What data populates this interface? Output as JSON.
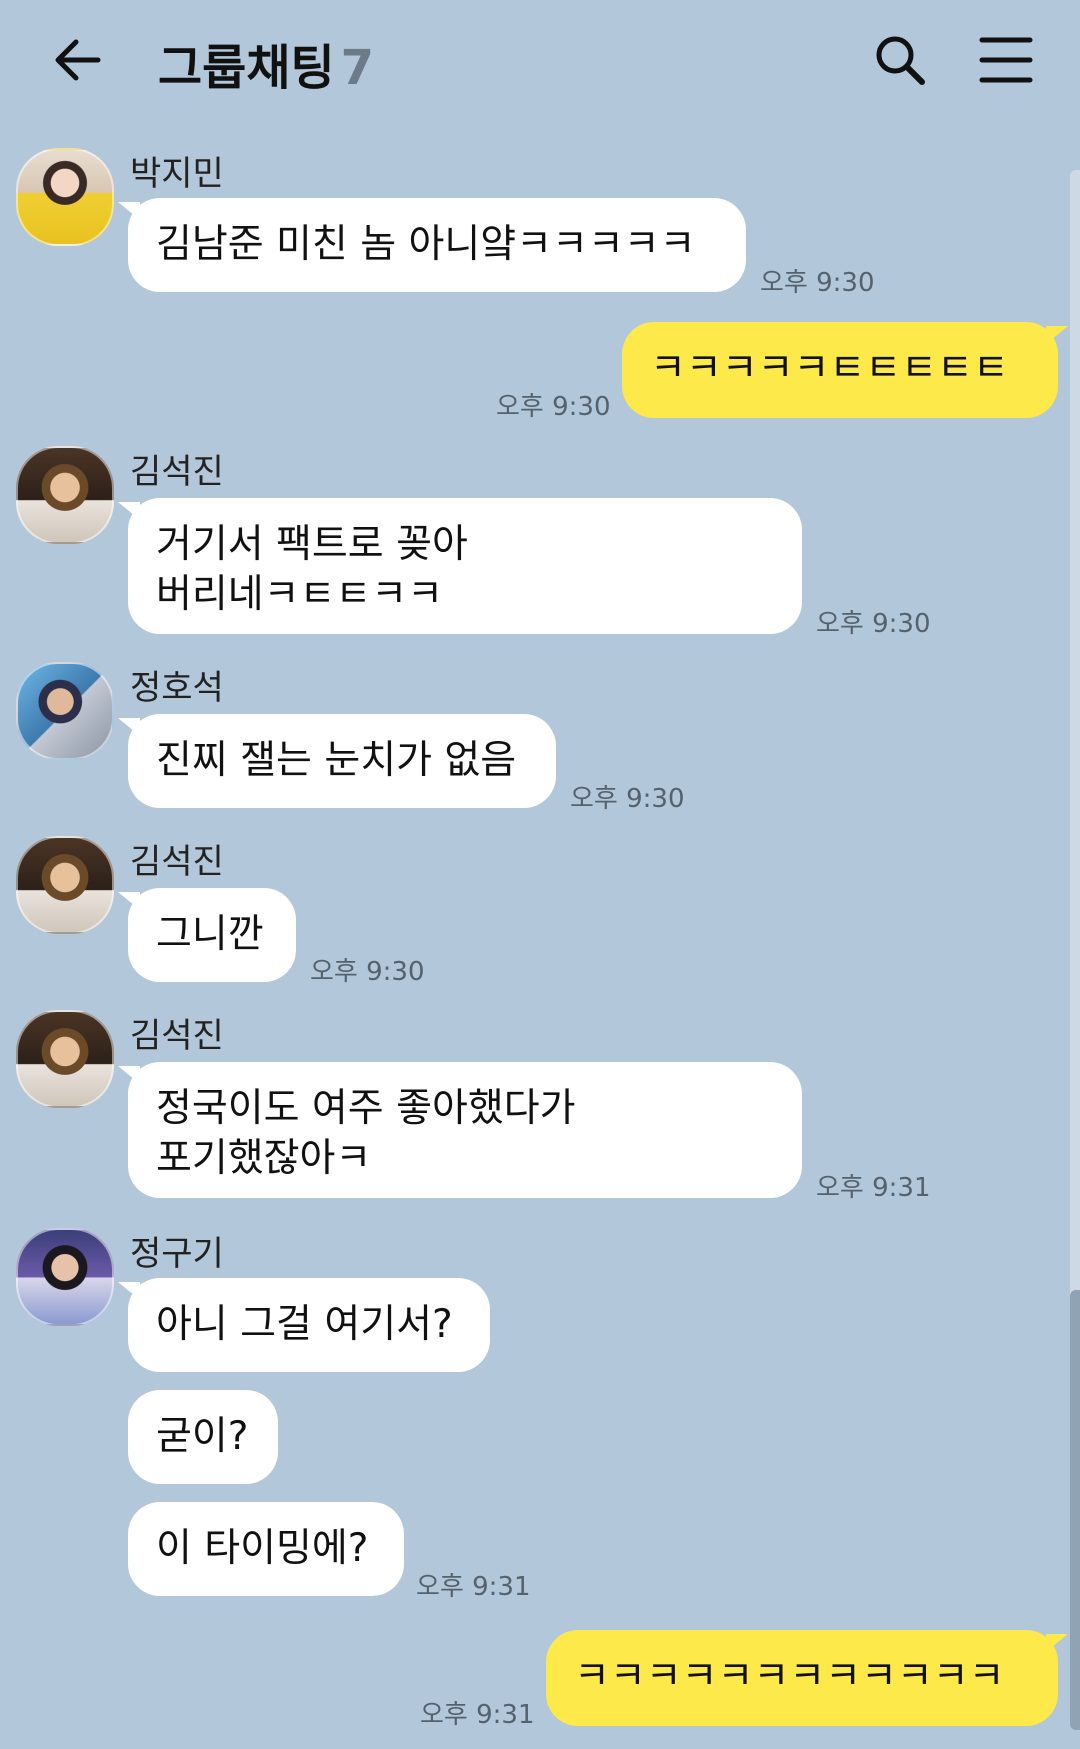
{
  "header": {
    "title": "그룹채팅",
    "member_count": "7"
  },
  "messages": [
    {
      "sender": "박지민",
      "text": "김남준 미친 놈 아니얔ㅋㅋㅋㅋㅋ",
      "time": "오후 9:30"
    },
    {
      "sender": "me",
      "text": "ㅋㅋㅋㅋㅋㅌㅌㅌㅌㅌ",
      "time": "오후 9:30"
    },
    {
      "sender": "김석진",
      "text_lines": [
        "거기서 팩트로 꽂아",
        "버리네ㅋㅌㅌㅋㅋ"
      ],
      "time": "오후 9:30"
    },
    {
      "sender": "정호석",
      "text": "진찌 잴는 눈치가 없음",
      "time": "오후 9:30"
    },
    {
      "sender": "김석진",
      "text": "그니깐",
      "time": "오후 9:30"
    },
    {
      "sender": "김석진",
      "text_lines": [
        "정국이도 여주 좋아했다가",
        "포기했잖아ㅋ"
      ],
      "time": "오후 9:31"
    },
    {
      "sender": "정구기",
      "texts": [
        "아니 그걸 여기서?",
        "굳이?",
        "이 타이밍에?"
      ],
      "time": "오후 9:31"
    },
    {
      "sender": "me",
      "text": "ㅋㅋㅋㅋㅋㅋㅋㅋㅋㅋㅋㅋ",
      "time": "오후 9:31"
    }
  ],
  "icons": {
    "back": "arrow-left-icon",
    "search": "search-icon",
    "menu": "hamburger-menu-icon"
  },
  "colors": {
    "background": "#b2c7d9",
    "my_bubble": "#fee94a",
    "other_bubble": "#ffffff"
  }
}
